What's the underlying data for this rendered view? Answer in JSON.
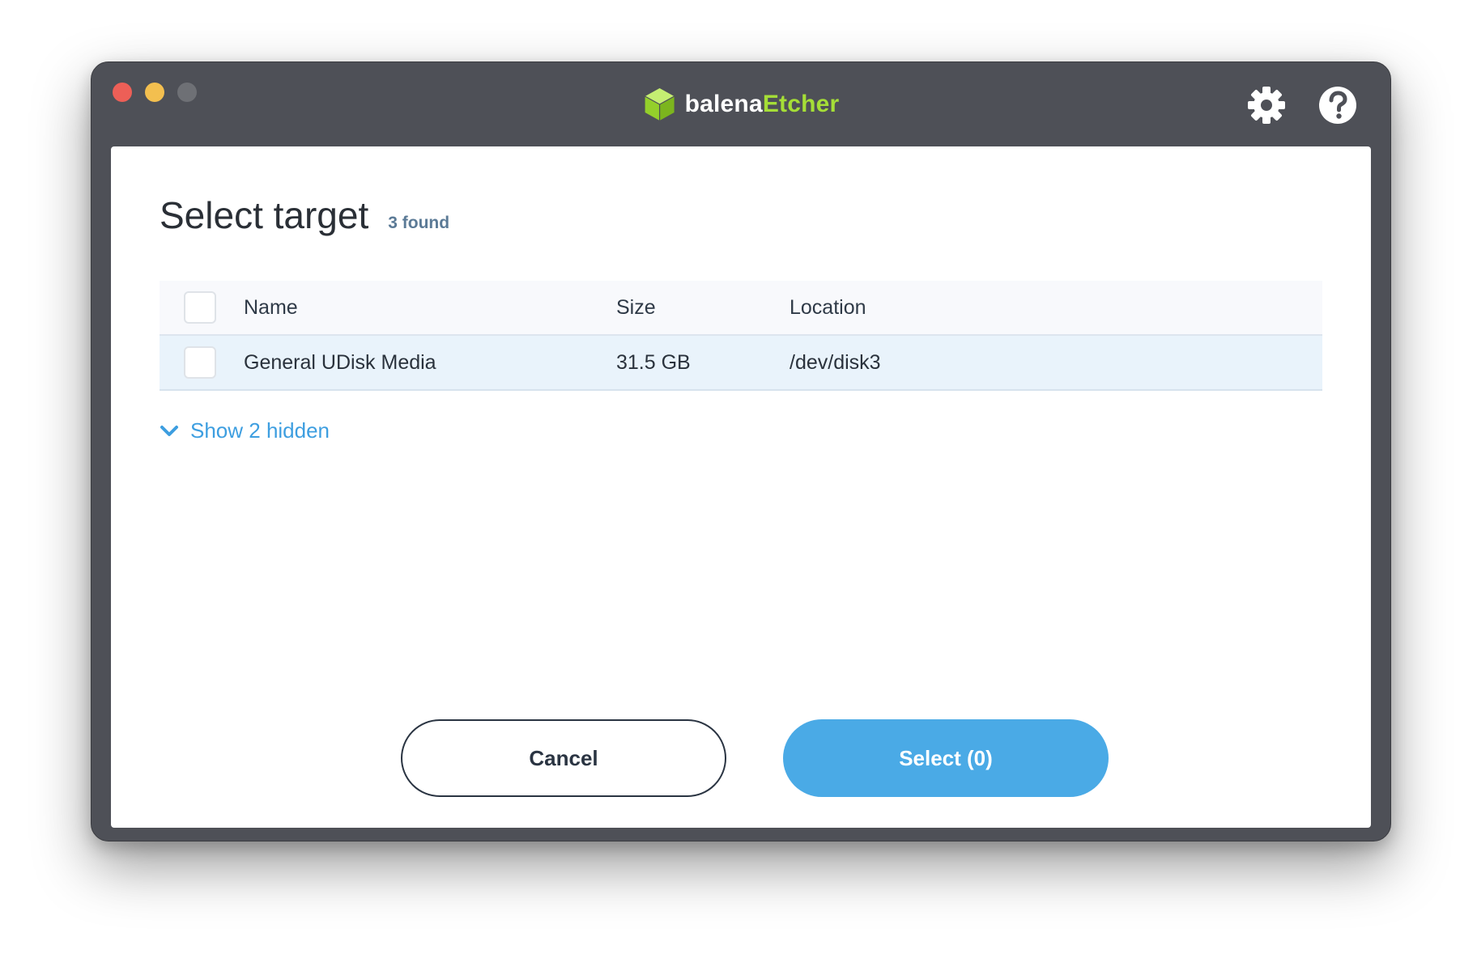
{
  "app": {
    "brand_part1": "balena",
    "brand_part2": "Etcher",
    "brand_color_primary": "#ffffff",
    "brand_color_accent": "#a5de37",
    "icons": {
      "settings": "gear-icon",
      "help": "help-icon",
      "logo": "cube-logo-icon"
    }
  },
  "dialog": {
    "title": "Select target",
    "found_label": "3 found",
    "columns": {
      "name": "Name",
      "size": "Size",
      "location": "Location"
    },
    "rows": [
      {
        "name": "General UDisk Media",
        "size": "31.5 GB",
        "location": "/dev/disk3",
        "selected": false
      }
    ],
    "show_hidden_label": "Show 2 hidden",
    "cancel_label": "Cancel",
    "select_label": "Select (0)",
    "accent_color": "#4aaae6",
    "row_highlight_color": "#e9f3fb"
  }
}
